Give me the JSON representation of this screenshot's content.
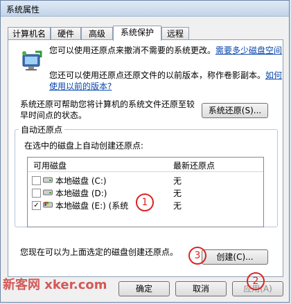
{
  "window": {
    "title": "系统属性"
  },
  "tabs": [
    {
      "label": "计算机名"
    },
    {
      "label": "硬件"
    },
    {
      "label": "高级"
    },
    {
      "label": "系统保护"
    },
    {
      "label": "远程"
    }
  ],
  "intro": {
    "line1": "您可以使用还原点来撤消不需要的系统更改。",
    "link1": "需要多少磁盘空间",
    "line2": "您还可以使用还原点还原文件的以前版本，称作卷影副本。",
    "link2": "如何使用以前的版本?"
  },
  "restore": {
    "text": "系统还原可帮助您将计算机的系统文件还原至较早时间点的状态。",
    "button": "系统还原(S)..."
  },
  "auto_restore": {
    "title": "自动还原点",
    "desc": "在选中的磁盘上自动创建还原点:",
    "col_disk": "可用磁盘",
    "col_latest": "最新还原点",
    "rows": [
      {
        "name": "本地磁盘 (C:)",
        "latest": "无",
        "checked": false,
        "icon": "drive-icon"
      },
      {
        "name": "本地磁盘 (D:)",
        "latest": "无",
        "checked": false,
        "icon": "drive-icon"
      },
      {
        "name": "本地磁盘 (E:) (系统",
        "latest": "无",
        "checked": true,
        "icon": "windows-drive-icon"
      }
    ]
  },
  "create": {
    "text": "您现在可以为上面选定的磁盘创建还原点。",
    "button": "创建(C)..."
  },
  "footer": {
    "ok": "确定",
    "cancel": "取消",
    "apply": "应用(A)"
  },
  "annotations": [
    "1",
    "2",
    "3"
  ],
  "watermark": {
    "text": "新客网 xker.com"
  }
}
